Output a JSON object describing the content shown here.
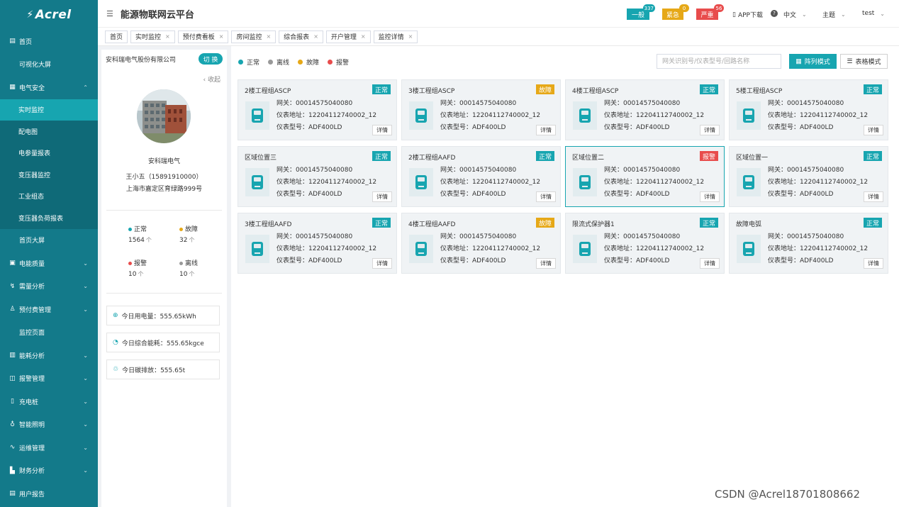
{
  "brand": {
    "logo_text": "Acrel",
    "logo_mark": "⚡"
  },
  "header": {
    "title": "能源物联网云平台",
    "alerts": [
      {
        "label": "一般",
        "count": "337",
        "color": "#17a5b0"
      },
      {
        "label": "紧急",
        "count": "0",
        "color": "#e6a817"
      },
      {
        "label": "严重",
        "count": "56",
        "color": "#e84c4c"
      }
    ],
    "app_download": "APP下载",
    "language": "中文",
    "theme": "主题",
    "user": "test"
  },
  "sidebar": {
    "items": [
      {
        "label": "首页",
        "icon": "home-icon",
        "glyph": "▤"
      },
      {
        "label": "可视化大屏",
        "icon": "",
        "glyph": ""
      },
      {
        "label": "电气安全",
        "icon": "safety-icon",
        "glyph": "▦",
        "chevron": "up"
      }
    ],
    "sub_items": [
      {
        "label": "实时监控",
        "active": true
      },
      {
        "label": "配电图"
      },
      {
        "label": "电参量报表"
      },
      {
        "label": "变压器监控"
      },
      {
        "label": "工业组态"
      },
      {
        "label": "变压器负荷报表"
      }
    ],
    "items_after": [
      {
        "label": "首页大屏",
        "icon": "",
        "glyph": ""
      },
      {
        "label": "电能质量",
        "icon": "power-quality-icon",
        "glyph": "▣",
        "chevron": "down"
      },
      {
        "label": "需量分析",
        "icon": "demand-icon",
        "glyph": "↯",
        "chevron": "down"
      },
      {
        "label": "预付费管理",
        "icon": "prepay-icon",
        "glyph": "♙",
        "chevron": "down"
      },
      {
        "label": "监控页面",
        "icon": "",
        "glyph": ""
      },
      {
        "label": "能耗分析",
        "icon": "energy-icon",
        "glyph": "▥",
        "chevron": "down"
      },
      {
        "label": "报警管理",
        "icon": "alarm-icon",
        "glyph": "◫",
        "chevron": "down"
      },
      {
        "label": "充电桩",
        "icon": "charger-icon",
        "glyph": "▯",
        "chevron": "down"
      },
      {
        "label": "智能照明",
        "icon": "lighting-icon",
        "glyph": "♁",
        "chevron": "down"
      },
      {
        "label": "运维管理",
        "icon": "maintenance-icon",
        "glyph": "∿",
        "chevron": "down"
      },
      {
        "label": "财务分析",
        "icon": "finance-icon",
        "glyph": "▙",
        "chevron": "down"
      },
      {
        "label": "用户报告",
        "icon": "report-icon",
        "glyph": "▤",
        "chevron": ""
      }
    ]
  },
  "tags": [
    {
      "label": "首页",
      "closable": false
    },
    {
      "label": "实时监控",
      "closable": true
    },
    {
      "label": "预付费看板",
      "closable": true
    },
    {
      "label": "房间监控",
      "closable": true
    },
    {
      "label": "综合报表",
      "closable": true
    },
    {
      "label": "开户管理",
      "closable": true
    },
    {
      "label": "监控详情",
      "closable": true
    }
  ],
  "company": {
    "name": "安科瑞电气股份有限公司",
    "switch_label": "切 换",
    "collapse_label": "‹ 收起",
    "short_name": "安科瑞电气",
    "contact": "王小五（15891910000）",
    "address": "上海市嘉定区育绿路999号",
    "stats": [
      {
        "label": "正常",
        "count": "1564",
        "unit": "个",
        "color": "#17a5b0"
      },
      {
        "label": "故障",
        "count": "32",
        "unit": "个",
        "color": "#e6a817"
      },
      {
        "label": "报警",
        "count": "10",
        "unit": "个",
        "color": "#e84c4c"
      },
      {
        "label": "离线",
        "count": "10",
        "unit": "个",
        "color": "#999999"
      }
    ],
    "kpis": [
      {
        "icon": "power-icon",
        "glyph": "⊕",
        "text": "今日用电量：555.65kWh"
      },
      {
        "icon": "energy-consumption-icon",
        "glyph": "◔",
        "text": "今日综合能耗：555.65kgce"
      },
      {
        "icon": "carbon-icon",
        "glyph": "♲",
        "text": "今日碳排放：555.65t"
      }
    ]
  },
  "main": {
    "legend": [
      {
        "label": "正常",
        "color": "#17a5b0"
      },
      {
        "label": "离线",
        "color": "#999999"
      },
      {
        "label": "故障",
        "color": "#e6a817"
      },
      {
        "label": "报警",
        "color": "#e84c4c"
      }
    ],
    "search_placeholder": "网关识别号/仪表型号/回路名称",
    "grid_mode_label": "阵列模式",
    "table_mode_label": "表格模式",
    "gateway_prefix": "网关：",
    "address_prefix": "仪表地址：",
    "model_prefix": "仪表型号：",
    "detail_label": "详情",
    "status_colors": {
      "正常": "#17a5b0",
      "故障": "#e6a817",
      "报警": "#e84c4c"
    },
    "cards": [
      {
        "title": "2楼工程组ASCP",
        "status": "正常",
        "gateway": "00014575040080",
        "address": "12204112740002_12",
        "model": "ADF400LD"
      },
      {
        "title": "3楼工程组ASCP",
        "status": "故障",
        "gateway": "00014575040080",
        "address": "12204112740002_12",
        "model": "ADF400LD"
      },
      {
        "title": "4楼工程组ASCP",
        "status": "正常",
        "gateway": "00014575040080",
        "address": "12204112740002_12",
        "model": "ADF400LD"
      },
      {
        "title": "5楼工程组ASCP",
        "status": "正常",
        "gateway": "00014575040080",
        "address": "12204112740002_12",
        "model": "ADF400LD"
      },
      {
        "title": "区域位置三",
        "status": "正常",
        "gateway": "00014575040080",
        "address": "12204112740002_12",
        "model": "ADF400LD"
      },
      {
        "title": "2楼工程组AAFD",
        "status": "正常",
        "gateway": "00014575040080",
        "address": "12204112740002_12",
        "model": "ADF400LD"
      },
      {
        "title": "区域位置二",
        "status": "报警",
        "gateway": "00014575040080",
        "address": "12204112740002_12",
        "model": "ADF400LD",
        "selected": true
      },
      {
        "title": "区域位置一",
        "status": "正常",
        "gateway": "00014575040080",
        "address": "12204112740002_12",
        "model": "ADF400LD"
      },
      {
        "title": "3楼工程组AAFD",
        "status": "正常",
        "gateway": "00014575040080",
        "address": "12204112740002_12",
        "model": "ADF400LD"
      },
      {
        "title": "4楼工程组AAFD",
        "status": "故障",
        "gateway": "00014575040080",
        "address": "12204112740002_12",
        "model": "ADF400LD"
      },
      {
        "title": "限流式保护器1",
        "status": "正常",
        "gateway": "00014575040080",
        "address": "12204112740002_12",
        "model": "ADF400LD"
      },
      {
        "title": "故障电弧",
        "status": "正常",
        "gateway": "00014575040080",
        "address": "12204112740002_12",
        "model": "ADF400LD"
      }
    ]
  },
  "watermark": "CSDN @Acrel18701808662"
}
